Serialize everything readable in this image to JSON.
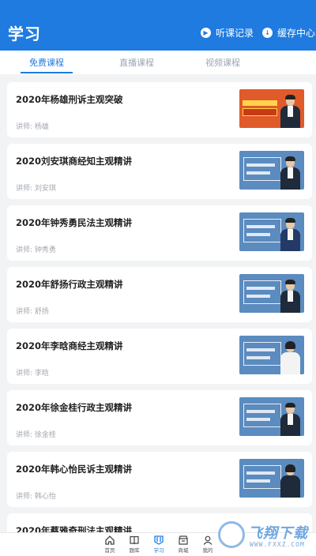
{
  "header": {
    "title": "学习",
    "listen_record": "听课记录",
    "cache_center": "缓存中心"
  },
  "tabs": [
    "免费课程",
    "直播课程",
    "视频课程"
  ],
  "courses": [
    {
      "title": "2020年杨雄刑诉主观突破",
      "lecturer": "讲师: 杨雄"
    },
    {
      "title": "2020刘安琪商经知主观精讲",
      "lecturer": "讲师: 刘安琪"
    },
    {
      "title": "2020年钟秀勇民法主观精讲",
      "lecturer": "讲师: 钟秀勇"
    },
    {
      "title": "2020年舒扬行政主观精讲",
      "lecturer": "讲师: 舒扬"
    },
    {
      "title": "2020年李晗商经主观精讲",
      "lecturer": "讲师: 李晗"
    },
    {
      "title": "2020年徐金桂行政主观精讲",
      "lecturer": "讲师: 徐金桂"
    },
    {
      "title": "2020年韩心怡民诉主观精讲",
      "lecturer": "讲师: 韩心怡"
    },
    {
      "title": "2020年蔡雅奇刑法主观精讲",
      "lecturer": ""
    }
  ],
  "nav": [
    "首页",
    "题库",
    "学习",
    "商城",
    "我的"
  ],
  "watermark": {
    "text": "飞翔下载",
    "url": "WWW.FXXZ.COM"
  },
  "colors": {
    "primary": "#1f7be0",
    "background": "#f2f3f5"
  }
}
